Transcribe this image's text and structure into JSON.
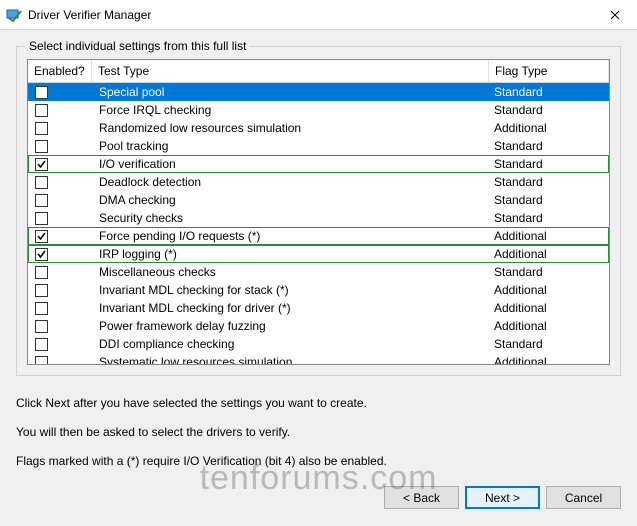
{
  "window": {
    "title": "Driver Verifier Manager"
  },
  "group": {
    "legend": "Select individual settings from this full list"
  },
  "columns": {
    "enabled": "Enabled?",
    "test": "Test Type",
    "flag": "Flag Type"
  },
  "rows": [
    {
      "checked": false,
      "test": "Special pool",
      "flag": "Standard",
      "selected": true
    },
    {
      "checked": false,
      "test": "Force IRQL checking",
      "flag": "Standard"
    },
    {
      "checked": false,
      "test": "Randomized low resources simulation",
      "flag": "Additional"
    },
    {
      "checked": false,
      "test": "Pool tracking",
      "flag": "Standard"
    },
    {
      "checked": true,
      "test": "I/O verification",
      "flag": "Standard",
      "marked": true
    },
    {
      "checked": false,
      "test": "Deadlock detection",
      "flag": "Standard"
    },
    {
      "checked": false,
      "test": "DMA checking",
      "flag": "Standard"
    },
    {
      "checked": false,
      "test": "Security checks",
      "flag": "Standard"
    },
    {
      "checked": true,
      "test": "Force pending I/O requests (*)",
      "flag": "Additional",
      "marked": true
    },
    {
      "checked": true,
      "test": "IRP logging (*)",
      "flag": "Additional",
      "marked": true
    },
    {
      "checked": false,
      "test": "Miscellaneous checks",
      "flag": "Standard"
    },
    {
      "checked": false,
      "test": "Invariant MDL checking for stack (*)",
      "flag": "Additional"
    },
    {
      "checked": false,
      "test": "Invariant MDL checking for driver (*)",
      "flag": "Additional"
    },
    {
      "checked": false,
      "test": "Power framework delay fuzzing",
      "flag": "Additional"
    },
    {
      "checked": false,
      "test": "DDI compliance checking",
      "flag": "Standard"
    },
    {
      "checked": false,
      "test": "Systematic low resources simulation",
      "flag": "Additional"
    }
  ],
  "instructions": {
    "l1": "Click Next after you have selected the settings you want to create.",
    "l2": "You will then be asked to select the drivers to verify.",
    "l3": "Flags marked with a (*) require I/O Verification (bit 4) also be enabled."
  },
  "buttons": {
    "back": "< Back",
    "next": "Next >",
    "cancel": "Cancel"
  },
  "watermark": "tenforums.com"
}
